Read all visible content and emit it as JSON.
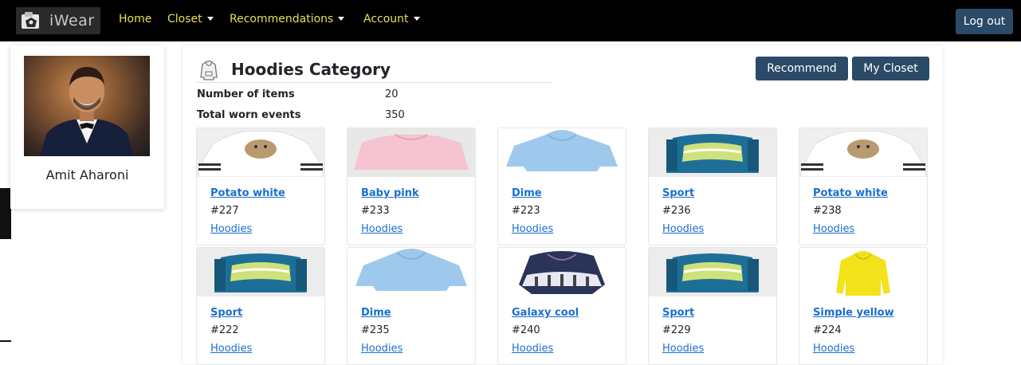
{
  "navbar": {
    "brand": "iWear",
    "home": "Home",
    "closet": "Closet",
    "recommendations": "Recommendations",
    "account": "Account",
    "logout": "Log out",
    "accent_color": "#e9df55",
    "button_color": "#2b4a67"
  },
  "profile": {
    "name": "Amit Aharoni"
  },
  "category": {
    "icon": "hoodie-icon",
    "title": "Hoodies Category",
    "recommend_label": "Recommend",
    "my_closet_label": "My Closet",
    "stats": [
      {
        "label": "Number of items",
        "value": "20"
      },
      {
        "label": "Total worn events",
        "value": "350"
      }
    ]
  },
  "items": [
    {
      "name": "Potato white",
      "id": "#227",
      "category": "Hoodies",
      "image": "white-hoodie-image"
    },
    {
      "name": "Baby pink",
      "id": "#233",
      "category": "Hoodies",
      "image": "pink-hoodie-image"
    },
    {
      "name": "Dime",
      "id": "#223",
      "category": "Hoodies",
      "image": "light-blue-hoodie-image"
    },
    {
      "name": "Sport",
      "id": "#236",
      "category": "Hoodies",
      "image": "sport-hoodie-image"
    },
    {
      "name": "Potato white",
      "id": "#238",
      "category": "Hoodies",
      "image": "white-hoodie-image"
    },
    {
      "name": "Sport",
      "id": "#222",
      "category": "Hoodies",
      "image": "sport-hoodie-image"
    },
    {
      "name": "Dime",
      "id": "#235",
      "category": "Hoodies",
      "image": "light-blue-hoodie-image"
    },
    {
      "name": "Galaxy cool",
      "id": "#240",
      "category": "Hoodies",
      "image": "galaxy-hoodie-image"
    },
    {
      "name": "Sport",
      "id": "#229",
      "category": "Hoodies",
      "image": "sport-hoodie-image"
    },
    {
      "name": "Simple yellow",
      "id": "#224",
      "category": "Hoodies",
      "image": "yellow-hoodie-image"
    }
  ]
}
